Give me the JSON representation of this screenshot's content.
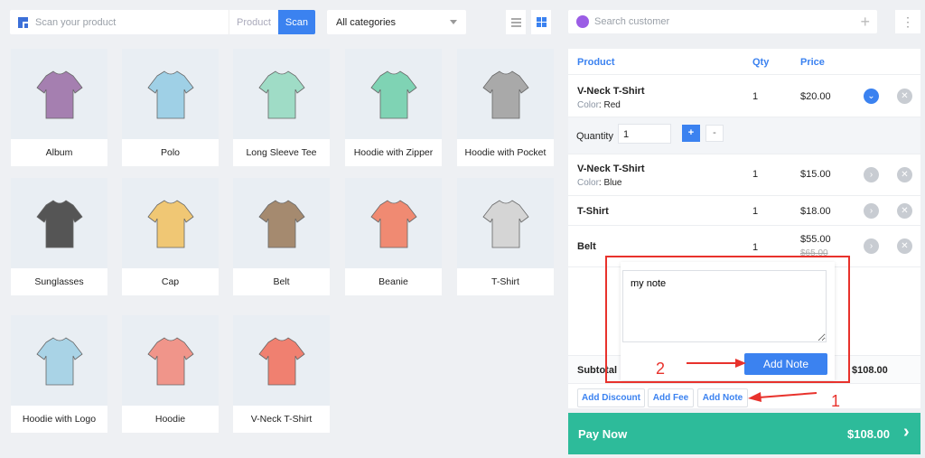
{
  "toolbar": {
    "scan_placeholder": "Scan your product",
    "product_label": "Product",
    "scan_label": "Scan",
    "category": "All categories"
  },
  "products": [
    {
      "label": "Album",
      "icon": "album-icon",
      "color": "#a57fb0"
    },
    {
      "label": "Polo",
      "icon": "polo-icon",
      "color": "#9fd0e6"
    },
    {
      "label": "Long Sleeve Tee",
      "icon": "long-sleeve-icon",
      "color": "#9fdcc6"
    },
    {
      "label": "Hoodie with Zipper",
      "icon": "hoodie-zipper-icon",
      "color": "#7fd3b4"
    },
    {
      "label": "Hoodie with Pocket",
      "icon": "hoodie-pocket-icon",
      "color": "#a9a9a9"
    },
    {
      "label": "Sunglasses",
      "icon": "sunglasses-icon",
      "color": "#555555"
    },
    {
      "label": "Cap",
      "icon": "cap-icon",
      "color": "#f0c774"
    },
    {
      "label": "Belt",
      "icon": "belt-icon",
      "color": "#a58a6f"
    },
    {
      "label": "Beanie",
      "icon": "beanie-icon",
      "color": "#f08a72"
    },
    {
      "label": "T-Shirt",
      "icon": "tshirt-icon",
      "color": "#d5d5d5"
    },
    {
      "label": "Hoodie with Logo",
      "icon": "hoodie-logo-icon",
      "color": "#a9d3e6"
    },
    {
      "label": "Hoodie",
      "icon": "hoodie-icon",
      "color": "#f0958a"
    },
    {
      "label": "V-Neck T-Shirt",
      "icon": "vneck-icon",
      "color": "#f08070"
    }
  ],
  "customer": {
    "placeholder": "Search customer"
  },
  "cart": {
    "headers": {
      "product": "Product",
      "qty": "Qty",
      "price": "Price"
    },
    "items": [
      {
        "name": "V-Neck T-Shirt",
        "attr_label": "Color",
        "attr_value": "Red",
        "qty": "1",
        "price": "$20.00",
        "expanded": true
      },
      {
        "name": "V-Neck T-Shirt",
        "attr_label": "Color",
        "attr_value": "Blue",
        "qty": "1",
        "price": "$15.00"
      },
      {
        "name": "T-Shirt",
        "qty": "1",
        "price": "$18.00"
      },
      {
        "name": "Belt",
        "qty": "1",
        "price": "$55.00",
        "old_price": "$65.00"
      }
    ],
    "quantity_label": "Quantity",
    "quantity_value": "1",
    "plus": "+",
    "minus": "-",
    "subtotal_label": "Subtotal",
    "subtotal": "$108.00",
    "actions": [
      "Add Discount",
      "Add Fee",
      "Add Note"
    ],
    "pay_label": "Pay Now",
    "pay_total": "$108.00"
  },
  "note_popup": {
    "text": "my note",
    "button": "Add Note"
  },
  "annotations": {
    "one": "1",
    "two": "2"
  },
  "colors": {
    "accent": "#3b82f0",
    "pay": "#2dbb9a",
    "annotation": "#e8322c"
  }
}
